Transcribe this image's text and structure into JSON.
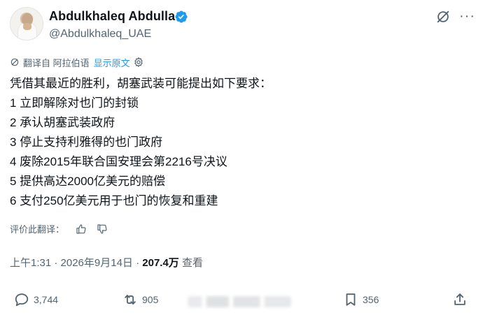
{
  "author": {
    "name": "Abdulkhaleq Abdulla",
    "handle": "@Abdulkhaleq_UAE",
    "verified_color": "#1d9bf0"
  },
  "translation": {
    "label": "翻译自 阿拉伯语",
    "show_original": "显示原文"
  },
  "post": {
    "lines": [
      "凭借其最近的胜利，胡塞武装可能提出如下要求：",
      "1 立即解除对也门的封锁",
      "2 承认胡塞武装政府",
      "3 停止支持利雅得的也门政府",
      "4 废除2015年联合国安理会第2216号决议",
      "5 提供高达2000亿美元的赔偿",
      "6 支付250亿美元用于也门的恢复和重建"
    ]
  },
  "rating": {
    "label": "评价此翻译："
  },
  "meta": {
    "timestamp": "上午1:31 · 2026年9月14日 · ",
    "views_count": "207.4万",
    "views_label": " 查看"
  },
  "actions": {
    "replies": "3,744",
    "reposts": "905",
    "bookmarks": "356"
  },
  "icons": [
    "grok-icon",
    "more-icon",
    "verified-badge-icon",
    "translate-icon",
    "settings-gear-icon",
    "thumbs-up-icon",
    "thumbs-down-icon",
    "reply-icon",
    "repost-icon",
    "bookmark-icon",
    "share-icon"
  ],
  "colors": {
    "accent": "#1d9bf0",
    "secondary_text": "#536471",
    "primary_text": "#0f1419"
  }
}
